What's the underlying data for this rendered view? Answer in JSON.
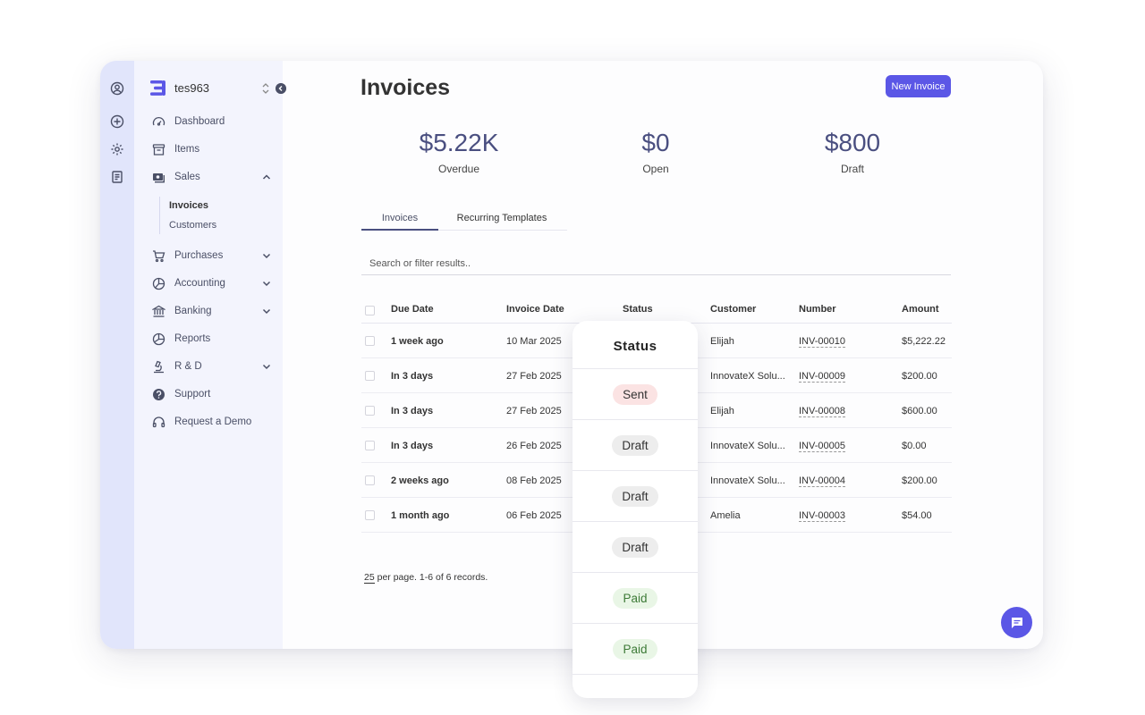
{
  "org": {
    "name": "tes963"
  },
  "colors": {
    "accent": "#5b57e6",
    "rail": "#e1e5fb",
    "sidebar": "#f3f4fd",
    "sent": "#fbe3e3",
    "draft": "#ededed",
    "paid": "#e9f6e6"
  },
  "rail_icons": [
    "user-circle-icon",
    "plus-circle-icon",
    "gear-icon",
    "document-icon"
  ],
  "nav": {
    "dashboard": "Dashboard",
    "items": "Items",
    "sales": "Sales",
    "invoices": "Invoices",
    "customers": "Customers",
    "purchases": "Purchases",
    "accounting": "Accounting",
    "banking": "Banking",
    "reports": "Reports",
    "rnd": "R & D",
    "support": "Support",
    "demo": "Request a Demo"
  },
  "page": {
    "title": "Invoices",
    "new_button": "New Invoice"
  },
  "stats": [
    {
      "value": "$5.22K",
      "label": "Overdue"
    },
    {
      "value": "$0",
      "label": "Open"
    },
    {
      "value": "$800",
      "label": "Draft"
    }
  ],
  "tabs": [
    "Invoices",
    "Recurring Templates"
  ],
  "search": {
    "placeholder": "Search or filter results.."
  },
  "table": {
    "headers": [
      "Due Date",
      "Invoice Date",
      "Status",
      "Customer",
      "Number",
      "Amount"
    ],
    "rows": [
      {
        "due": "1 week ago",
        "date": "10 Mar 2025",
        "customer": "Elijah",
        "number": "INV-00010",
        "amount": "$5,222.22"
      },
      {
        "due": "In 3 days",
        "date": "27 Feb 2025",
        "customer": "InnovateX Solu...",
        "number": "INV-00009",
        "amount": "$200.00"
      },
      {
        "due": "In 3 days",
        "date": "27 Feb 2025",
        "customer": "Elijah",
        "number": "INV-00008",
        "amount": "$600.00"
      },
      {
        "due": "In 3 days",
        "date": "26 Feb 2025",
        "customer": "InnovateX Solu...",
        "number": "INV-00005",
        "amount": "$0.00"
      },
      {
        "due": "2 weeks ago",
        "date": "08 Feb 2025",
        "customer": "InnovateX Solu...",
        "number": "INV-00004",
        "amount": "$200.00"
      },
      {
        "due": "1 month ago",
        "date": "06 Feb 2025",
        "customer": "Amelia",
        "number": "INV-00003",
        "amount": "$54.00"
      }
    ]
  },
  "pager": {
    "per_page": "25",
    "text": " per page. 1-6 of 6 records."
  },
  "status_popup": {
    "title": "Status",
    "items": [
      "Sent",
      "Draft",
      "Draft",
      "Draft",
      "Paid",
      "Paid"
    ]
  }
}
